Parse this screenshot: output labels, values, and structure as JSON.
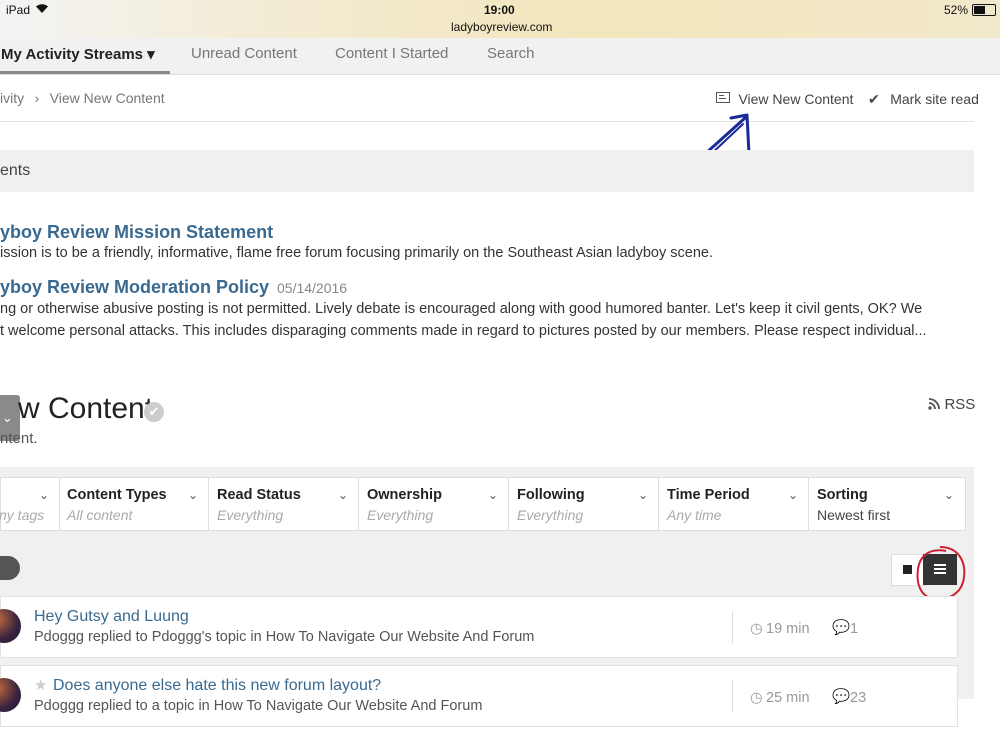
{
  "status_bar": {
    "device": "iPad",
    "time": "19:00",
    "url": "ladyboyreview.com",
    "battery": "52%"
  },
  "nav": {
    "tabs": [
      {
        "label": "My Activity Streams ▾"
      },
      {
        "label": "Unread Content"
      },
      {
        "label": "Content I Started"
      },
      {
        "label": "Search"
      }
    ]
  },
  "breadcrumb": {
    "parent": "ivity",
    "sep": "›",
    "current": "View New Content"
  },
  "header_actions": {
    "view_new": "View New Content",
    "mark_read": "Mark site read"
  },
  "announcements": {
    "heading": "ents",
    "items": [
      {
        "title": "yboy Review Mission Statement",
        "date": "",
        "text1": "ission is to be a friendly, informative, flame free forum focusing primarily on the Southeast Asian ladyboy scene.",
        "text2": ""
      },
      {
        "title": "yboy Review Moderation Policy",
        "date": "05/14/2016",
        "text1": "ng or otherwise abusive posting is not permitted. Lively debate is encouraged along with good humored banter. Let's keep it civil gents, OK? We",
        "text2": "t welcome personal attacks.  This includes disparaging comments made in regard to pictures posted by our members. Please respect individual..."
      }
    ]
  },
  "section": {
    "title": "w Content",
    "subtitle": "ntent.",
    "rss": "RSS"
  },
  "filters": [
    {
      "label": "",
      "value": "ny tags"
    },
    {
      "label": "Content Types",
      "value": "All content"
    },
    {
      "label": "Read Status",
      "value": "Everything"
    },
    {
      "label": "Ownership",
      "value": "Everything"
    },
    {
      "label": "Following",
      "value": "Everything"
    },
    {
      "label": "Time Period",
      "value": "Any time"
    },
    {
      "label": "Sorting",
      "value": "Newest first"
    }
  ],
  "items": [
    {
      "title": "Hey Gutsy and Luung",
      "subtitle": "Pdoggg replied to Pdoggg's topic in How To Navigate Our Website And Forum",
      "time": "19 min",
      "replies": "1"
    },
    {
      "title": "Does anyone else hate this new forum layout?",
      "subtitle": "Pdoggg replied to a topic in How To Navigate Our Website And Forum",
      "time": "25 min",
      "replies": "23"
    }
  ],
  "colors": {
    "link": "#3a6a90",
    "annotation_blue": "#1a2a9a",
    "annotation_red": "#cc2233"
  }
}
